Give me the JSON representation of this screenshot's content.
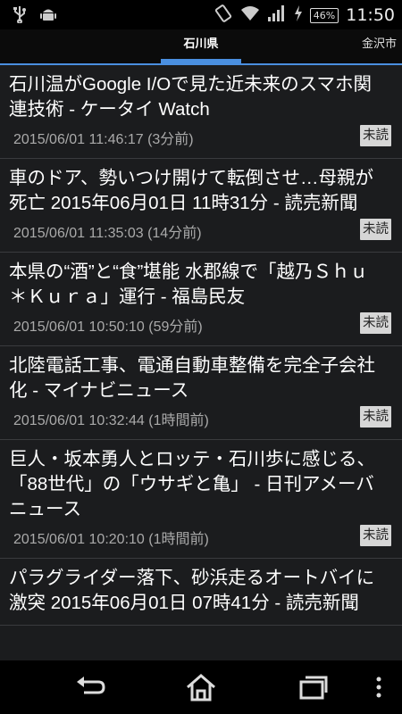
{
  "status_bar": {
    "icons_left": [
      "usb-icon",
      "android-icon"
    ],
    "icons_right": [
      "vibrate-icon",
      "wifi-icon",
      "signal-icon",
      "charging-icon"
    ],
    "battery": "46%",
    "time": "11:50"
  },
  "tabs": {
    "current": "石川県",
    "next": "金沢市"
  },
  "news": [
    {
      "title": "石川温がGoogle I/Oで見た近未来のスマホ関連技術 - ケータイ Watch",
      "date": "2015/06/01 11:46:17 (3分前)",
      "badge": "未読"
    },
    {
      "title": "車のドア、勢いつけ開けて転倒させ…母親が死亡 2015年06月01日 11時31分 - 読売新聞",
      "date": "2015/06/01 11:35:03 (14分前)",
      "badge": "未読"
    },
    {
      "title": "本県の“酒”と“食”堪能 水郡線で「越乃Ｓｈｕ＊Ｋｕｒａ」運行 - 福島民友",
      "date": "2015/06/01 10:50:10 (59分前)",
      "badge": "未読"
    },
    {
      "title": "北陸電話工事、電通自動車整備を完全子会社化 - マイナビニュース",
      "date": "2015/06/01 10:32:44 (1時間前)",
      "badge": "未読"
    },
    {
      "title": "巨人・坂本勇人とロッテ・石川歩に感じる、「88世代」の「ウサギと亀」 - 日刊アメーバニュース",
      "date": "2015/06/01 10:20:10 (1時間前)",
      "badge": "未読"
    },
    {
      "title": "パラグライダー落下、砂浜走るオートバイに激突 2015年06月01日 07時41分 - 読売新聞",
      "date": "",
      "badge": ""
    }
  ],
  "nav_bar": {
    "buttons": [
      "back-icon",
      "home-icon",
      "recent-apps-icon",
      "overflow-menu-icon"
    ]
  }
}
